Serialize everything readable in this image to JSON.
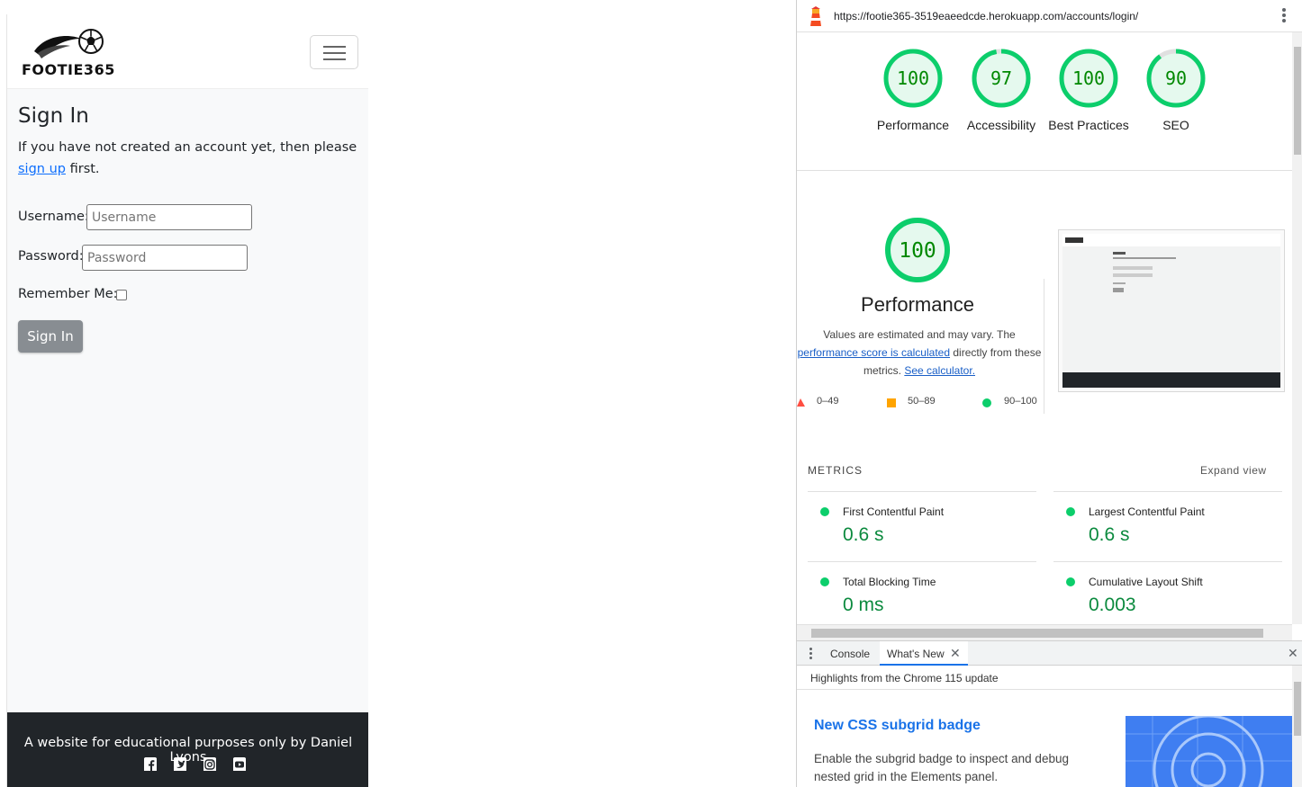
{
  "site": {
    "logo_text": "FOOTIE365",
    "title": "Sign In",
    "intro_prefix": "If you have not created an account yet, then please",
    "signup_link": "sign up",
    "intro_suffix": " first.",
    "username_label": "Username:",
    "username_placeholder": "Username",
    "password_label": "Password:",
    "password_placeholder": "Password",
    "remember_label": "Remember Me:",
    "signin_button": "Sign In",
    "footer_text": "A website for educational purposes only by Daniel Lyons",
    "social_icons": [
      "facebook-icon",
      "twitter-icon",
      "instagram-icon",
      "youtube-icon"
    ]
  },
  "devtools": {
    "url": "https://footie365-3519eaeedcde.herokuapp.com/accounts/login/",
    "scores": [
      {
        "value": "100",
        "label": "Performance"
      },
      {
        "value": "97",
        "label": "Accessibility"
      },
      {
        "value": "100",
        "label": "Best Practices"
      },
      {
        "value": "90",
        "label": "SEO"
      }
    ],
    "perf_score": "100",
    "perf_title": "Performance",
    "perf_desc_1": "Values are estimated and may vary. The",
    "perf_desc_link": "performance score is calculated",
    "perf_desc_2": "directly from these metrics.",
    "perf_desc_link2": "See calculator.",
    "legend": [
      "0–49",
      "50–89",
      "90–100"
    ],
    "metrics_header": "METRICS",
    "expand_view": "Expand view",
    "metrics": [
      {
        "name": "First Contentful Paint",
        "value": "0.6 s"
      },
      {
        "name": "Largest Contentful Paint",
        "value": "0.6 s"
      },
      {
        "name": "Total Blocking Time",
        "value": "0 ms"
      },
      {
        "name": "Cumulative Layout Shift",
        "value": "0.003"
      }
    ],
    "drawer": {
      "tabs": [
        "Console",
        "What's New"
      ],
      "subheader": "Highlights from the Chrome 115 update",
      "feature_title": "New CSS subgrid badge",
      "feature_desc": "Enable the subgrid badge to inspect and debug nested grid in the Elements panel."
    }
  },
  "colors": {
    "pass": "#0cce6b",
    "pass_text": "#008800",
    "average": "#ffa400",
    "fail": "#ff4e42",
    "link": "#0d6efd",
    "footer_bg": "#212529"
  }
}
